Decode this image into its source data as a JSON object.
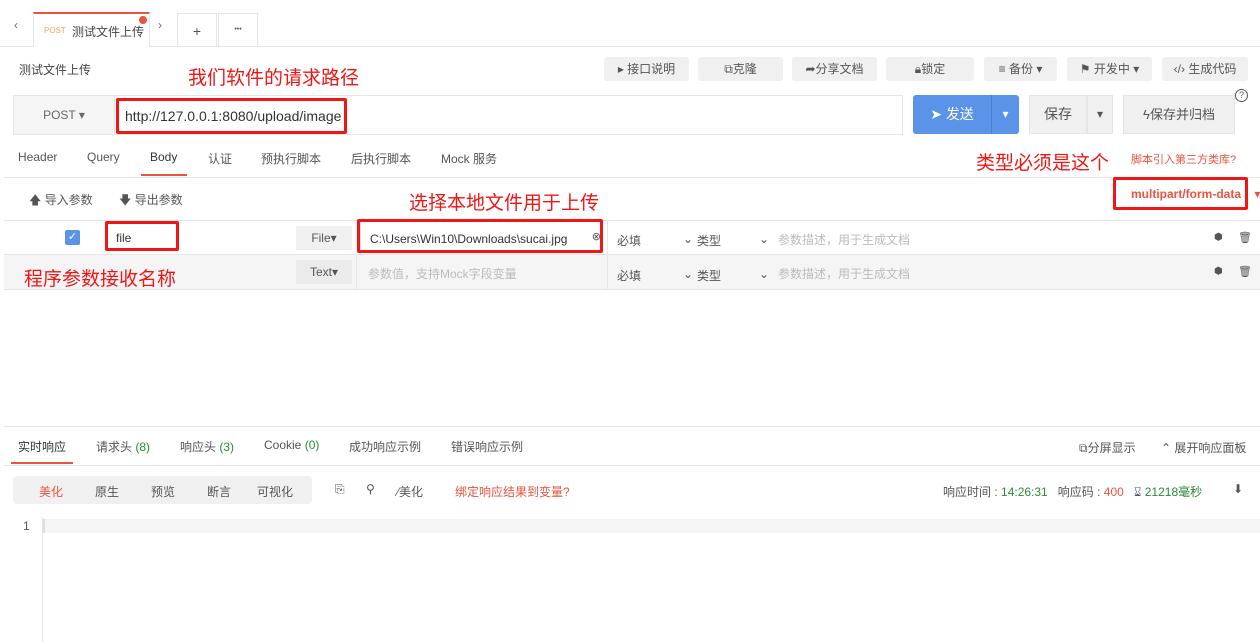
{
  "tabs": {
    "method": "POST",
    "title": "测试文件上传",
    "add": "+",
    "more": "•••"
  },
  "header": {
    "title": "测试文件上传",
    "buttons": [
      "接口说明",
      "克隆",
      "分享文档",
      "锁定",
      "备份",
      "开发中",
      "生成代码"
    ]
  },
  "request": {
    "method": "POST",
    "url": "http://127.0.0.1:8080/upload/image",
    "send": "发送",
    "save": "保存",
    "save_archive": "保存并归档"
  },
  "req_tabs": [
    "Header",
    "Query",
    "Body",
    "认证",
    "预执行脚本",
    "后执行脚本",
    "Mock 服务"
  ],
  "active_req_tab": "Body",
  "script_link": "脚本引入第三方类库?",
  "body": {
    "import": "导入参数",
    "export": "导出参数",
    "content_type": "multipart/form-data",
    "rows": [
      {
        "checked": true,
        "name": "file",
        "type": "File",
        "value": "C:\\Users\\Win10\\Downloads\\sucai.jpg",
        "required": "必填",
        "kind": "类型",
        "desc_placeholder": "参数描述，用于生成文档"
      },
      {
        "checked": false,
        "name": "",
        "type": "Text",
        "value_placeholder": "参数值，支持Mock字段变量",
        "required": "必填",
        "kind": "类型",
        "desc_placeholder": "参数描述，用于生成文档"
      }
    ]
  },
  "annotations": {
    "url": "我们软件的请求路径",
    "type": "类型必须是这个",
    "file": "选择本地文件用于上传",
    "name": "程序参数接收名称"
  },
  "response": {
    "tabs": [
      {
        "label": "实时响应",
        "count": ""
      },
      {
        "label": "请求头",
        "count": "(8)"
      },
      {
        "label": "响应头",
        "count": "(3)"
      },
      {
        "label": "Cookie",
        "count": "(0)"
      },
      {
        "label": "成功响应示例",
        "count": ""
      },
      {
        "label": "错误响应示例",
        "count": ""
      }
    ],
    "split": "分屏显示",
    "expand": "展开响应面板",
    "views": [
      "美化",
      "原生",
      "预览",
      "断言",
      "可视化"
    ],
    "beautify": "美化",
    "bind_link": "绑定响应结果到变量?",
    "time_label": "响应时间 :",
    "time": "14:26:31",
    "code_label": "响应码 :",
    "code": "400",
    "duration": "21218毫秒",
    "line": "1"
  },
  "colors": {
    "accent": "#e9543f",
    "send": "#5a93e8",
    "annotation": "#f01616",
    "green": "#2a8a3a"
  }
}
